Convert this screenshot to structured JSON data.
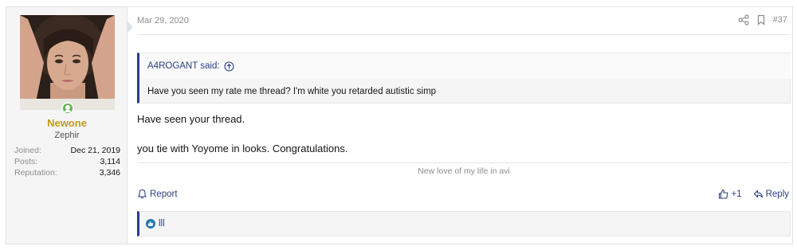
{
  "user": {
    "name": "Newone",
    "title": "Zephir",
    "stats": [
      {
        "label": "Joined:",
        "value": "Dec 21, 2019"
      },
      {
        "label": "Posts:",
        "value": "3,114"
      },
      {
        "label": "Reputation:",
        "value": "3,346"
      }
    ],
    "online_status": "online",
    "name_color": "#c29b1c"
  },
  "post": {
    "date": "Mar 29, 2020",
    "number": "#37",
    "quote": {
      "author": "A4ROGANT said:",
      "text": "Have you seen my rate me thread? I'm white you retarded autistic simp"
    },
    "paragraphs": [
      "Have seen your thread.",
      "you tie with Yoyome in looks. Congratulations."
    ],
    "signature": "New love of my life in avi"
  },
  "actions": {
    "report": "Report",
    "like": "+1",
    "reply": "Reply"
  },
  "reactions": {
    "summary": "lll"
  },
  "icons": {
    "share": "share-icon",
    "bookmark": "bookmark-icon",
    "quote_arrow": "arrow-up-circle-icon",
    "report": "bell-icon",
    "like": "thumbs-up-icon",
    "reply": "reply-icon",
    "reaction": "like-reaction-icon"
  },
  "colors": {
    "accent": "#2b3e83",
    "reaction_like": "#2577b1",
    "online": "#63b256"
  }
}
